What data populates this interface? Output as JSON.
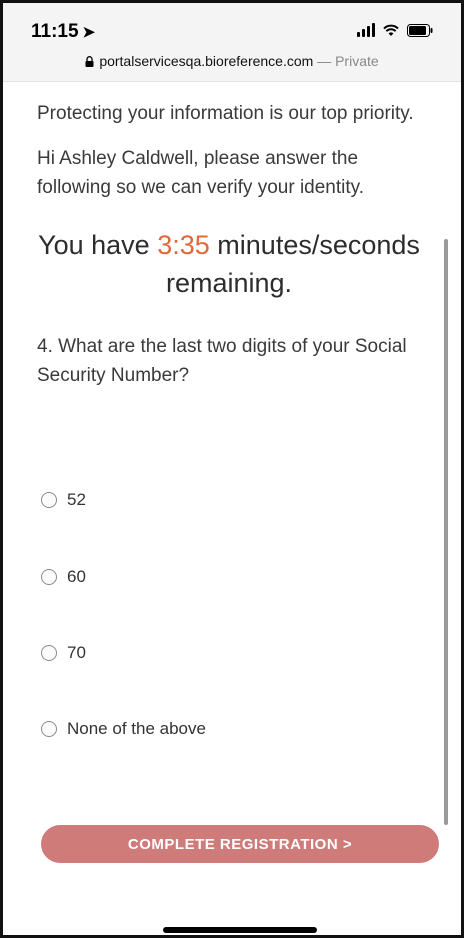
{
  "status_bar": {
    "time": "11:15",
    "location_icon": "location-arrow-icon",
    "icons": [
      "signal-icon",
      "wifi-icon",
      "battery-icon"
    ]
  },
  "address_bar": {
    "domain": "portalservicesqa.bioreference.com",
    "mode": "— Private",
    "icon": "lock-icon"
  },
  "content": {
    "intro": "Protecting your information is our top priority.",
    "greeting": "Hi Ashley Caldwell, please answer the following so we can verify your identity.",
    "timer_prefix": "You have",
    "timer_value": "3:35",
    "timer_suffix": "minutes/seconds remaining.",
    "question": "4. What are the last two digits of your Social Security Number?"
  },
  "options": [
    {
      "label": "52"
    },
    {
      "label": "60"
    },
    {
      "label": "70"
    },
    {
      "label": "None of the above"
    }
  ],
  "cta": {
    "label": "COMPLETE REGISTRATION >"
  },
  "colors": {
    "accent_timer": "#e0683a",
    "button": "#cf7b79"
  }
}
